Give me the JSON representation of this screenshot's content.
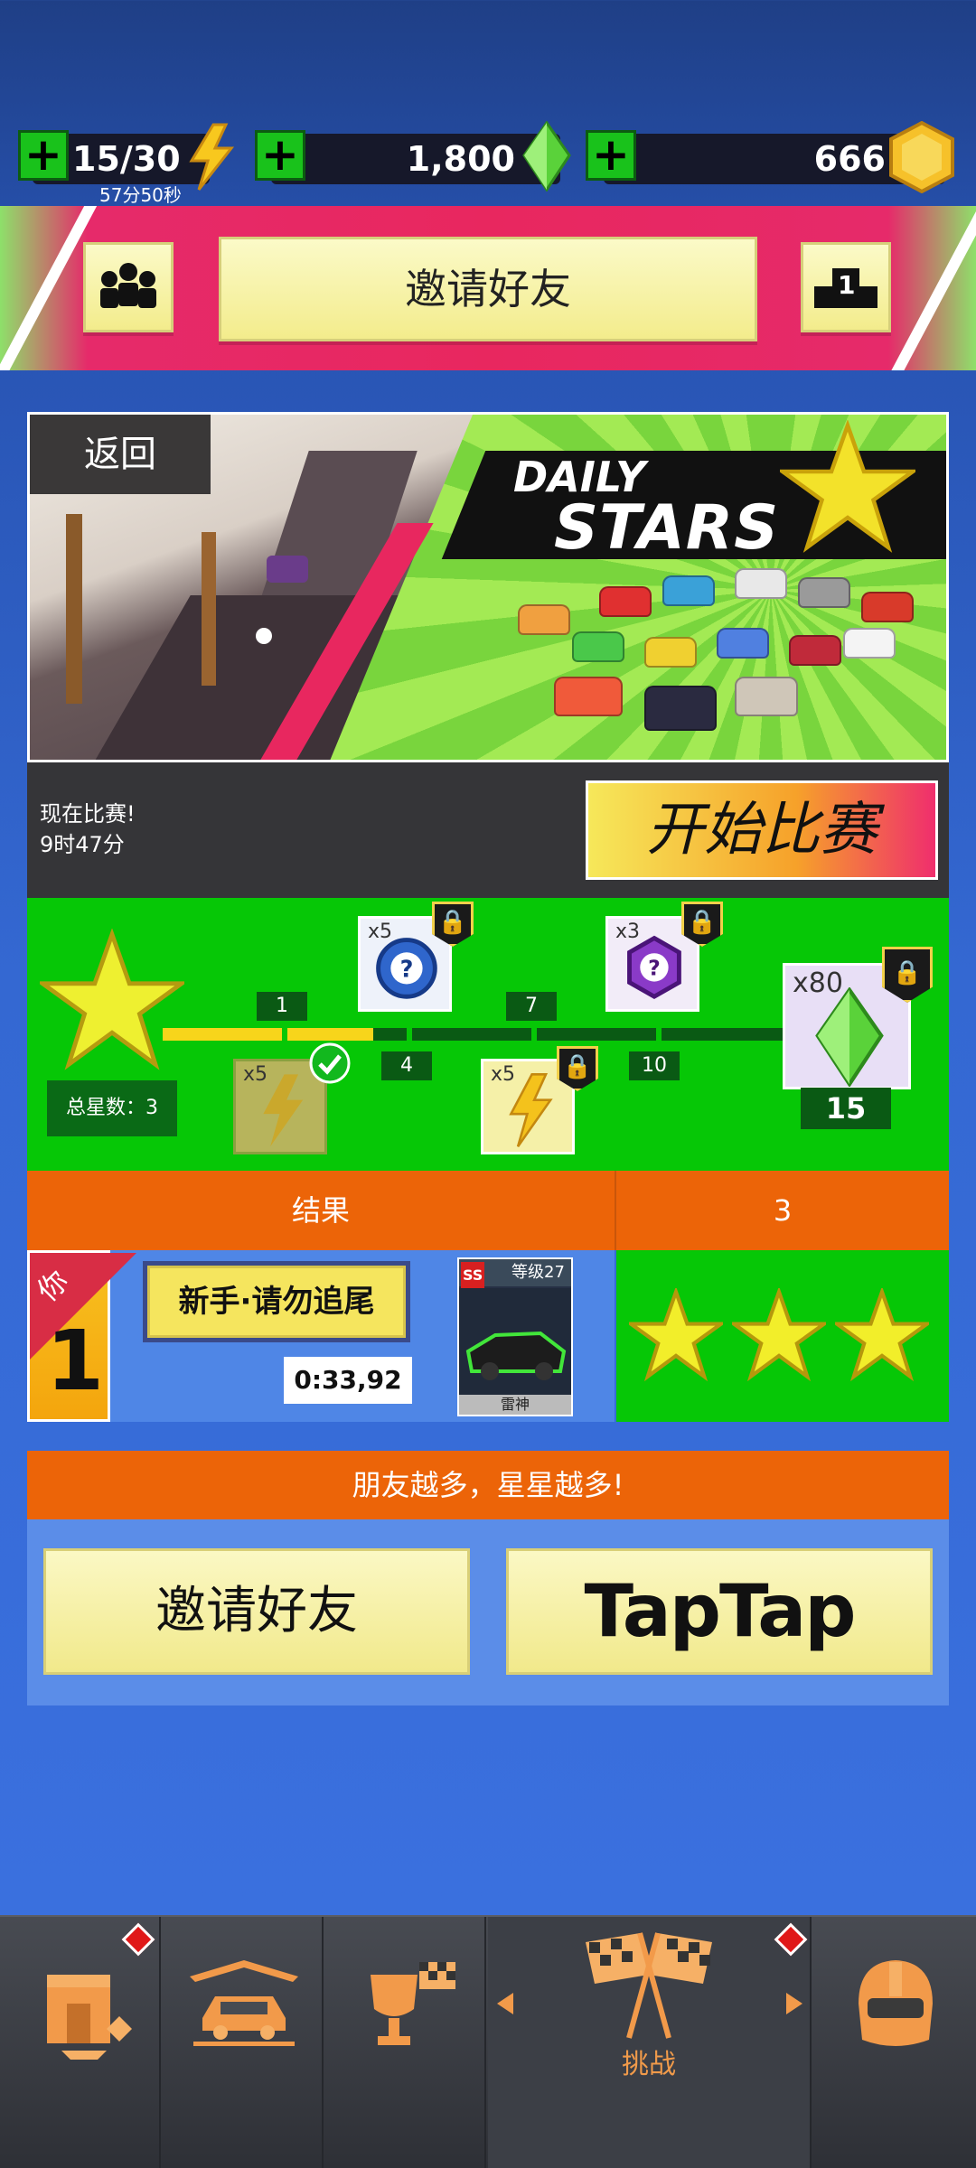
{
  "resources": {
    "energy": {
      "value": "15/30",
      "timer": "57分50秒"
    },
    "gems": {
      "value": "1,800"
    },
    "coins": {
      "value": "666"
    },
    "plus_label": "+"
  },
  "banner": {
    "title": "邀请好友",
    "rank_value": "1"
  },
  "event": {
    "back_label": "返回",
    "title_line1": "DAILY",
    "title_line2": "STARS",
    "status_line1": "现在比赛!",
    "status_line2": "9时47分",
    "start_button": "开始比赛"
  },
  "progress": {
    "total_stars_label": "总星数：3",
    "stars_collected": 3,
    "milestones": [
      "1",
      "4",
      "7",
      "10"
    ],
    "final_count": "15",
    "rewards": [
      {
        "label": "x5",
        "type": "energy",
        "claimed": true
      },
      {
        "label": "x5",
        "type": "mystery-blue",
        "locked": true
      },
      {
        "label": "x5",
        "type": "energy",
        "locked": true
      },
      {
        "label": "x3",
        "type": "mystery-purple",
        "locked": true
      },
      {
        "label": "x80",
        "type": "gem",
        "locked": true
      }
    ]
  },
  "results": {
    "header_left": "结果",
    "header_right": "3",
    "you_label": "你",
    "rank": "1",
    "player_name": "新手·请勿追尾",
    "time": "0:33,92",
    "car": {
      "class": "SS",
      "level": "等级27",
      "name": "雷神"
    },
    "stars": 3
  },
  "friends": {
    "header": "朋友越多，星星越多!",
    "invite_button": "邀请好友",
    "taptap_button": "TapTap"
  },
  "bottom_nav": {
    "active_label": "挑战"
  },
  "colors": {
    "accent_orange": "#ec6408",
    "green": "#06c706",
    "pink": "#e8275f",
    "yellow_button": "#f3ec8c"
  }
}
